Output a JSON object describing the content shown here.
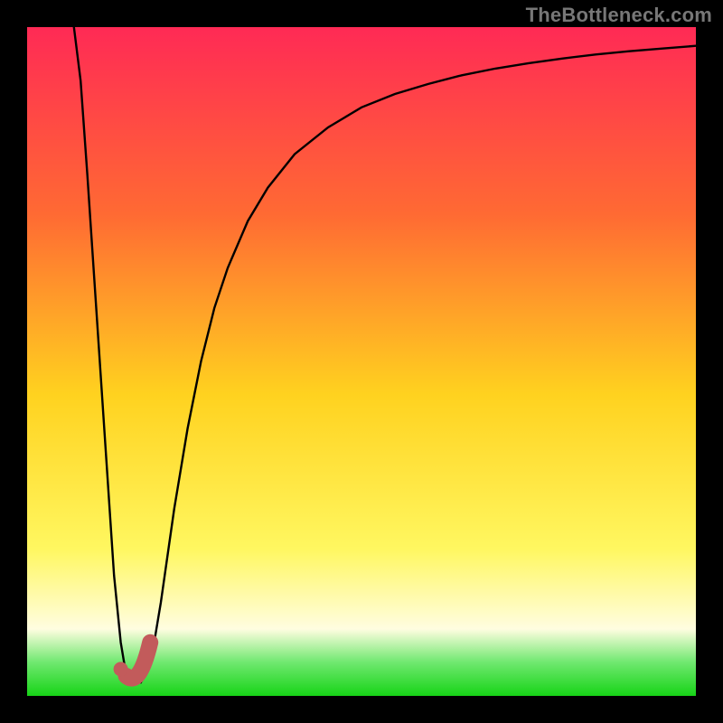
{
  "watermark": {
    "text": "TheBottleneck.com"
  },
  "colors": {
    "bg": "#000000",
    "curve": "#000000",
    "marker_stroke": "#c25b5b",
    "marker_fill": "#c25b5b",
    "grad_top": "#ff2a55",
    "grad_upper": "#ff6a33",
    "grad_mid": "#ffd21f",
    "grad_lowmid": "#fff760",
    "grad_cream": "#fffde0",
    "grad_green1": "#6fe86f",
    "grad_green2": "#17d417"
  },
  "frame": {
    "outer_w": 800,
    "outer_h": 800,
    "inner_x": 30,
    "inner_y": 30,
    "inner_w": 740,
    "inner_h": 740
  },
  "chart_data": {
    "type": "line",
    "title": "",
    "xlabel": "",
    "ylabel": "",
    "xlim": [
      0,
      100
    ],
    "ylim": [
      0,
      100
    ],
    "series": [
      {
        "name": "bottleneck-curve",
        "x": [
          7,
          8,
          9,
          10,
          11,
          12,
          13,
          14,
          15,
          16,
          17,
          18,
          19,
          20,
          21,
          22,
          24,
          26,
          28,
          30,
          33,
          36,
          40,
          45,
          50,
          55,
          60,
          65,
          70,
          75,
          80,
          85,
          90,
          95,
          100
        ],
        "y": [
          100,
          92,
          78,
          63,
          48,
          33,
          18,
          8,
          2,
          2,
          2,
          4,
          8,
          14,
          21,
          28,
          40,
          50,
          58,
          64,
          71,
          76,
          81,
          85,
          88,
          90,
          91.5,
          92.8,
          93.8,
          94.6,
          95.3,
          95.9,
          96.4,
          96.8,
          97.2
        ]
      }
    ],
    "marker": {
      "name": "J-marker",
      "dot": {
        "x": 14.0,
        "y": 4.0
      },
      "hook": {
        "start_x": 14.8,
        "start_y": 3.0,
        "bottom_x": 16.8,
        "bottom_y": 1.2,
        "end_x": 18.4,
        "end_y": 8.0
      }
    },
    "gradient_stops_pct_from_top": [
      {
        "pct": 0,
        "key": "grad_top"
      },
      {
        "pct": 28,
        "key": "grad_upper"
      },
      {
        "pct": 55,
        "key": "grad_mid"
      },
      {
        "pct": 78,
        "key": "grad_lowmid"
      },
      {
        "pct": 90,
        "key": "grad_cream"
      },
      {
        "pct": 95,
        "key": "grad_green1"
      },
      {
        "pct": 100,
        "key": "grad_green2"
      }
    ]
  }
}
